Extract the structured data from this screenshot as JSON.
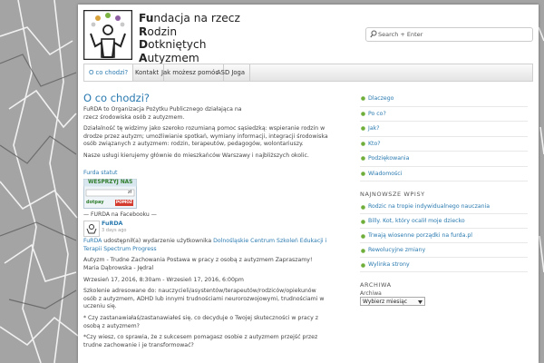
{
  "org": {
    "lines": [
      {
        "first": "Fu",
        "rest": "ndacja na rzecz"
      },
      {
        "first": "R",
        "rest": "odzin"
      },
      {
        "first": "D",
        "rest": "otkniętych"
      },
      {
        "first": "A",
        "rest": "utyzmem"
      }
    ]
  },
  "search": {
    "placeholder": "Search + Enter",
    "icon": "search-icon"
  },
  "nav": {
    "items": [
      "O co chodzi?",
      "Kontakt",
      "Jak możesz pomóc",
      "ASD Joga"
    ],
    "active_index": 0
  },
  "main": {
    "title": "O co chodzi?",
    "p1": "FuRDA to Organizacja Pożytku Publicznego działająca na rzecz środowiska osób z autyzmem.",
    "p2": "Działalność tę widzimy jako szeroko rozumianą pomoc sąsiedzką: wspieranie rodzin w drodze przez autyzm; umożliwianie spotkań, wymiany informacji, integracji środowiska osób związanych z autyzmem: rodzin, terapeutów, pedagogów, wolontariuszy.",
    "p3": "Nasze usługi kierujemy głównie do mieszkańców Warszawy i najbliższych okolic.",
    "statute_link": "Furda statut",
    "donate": {
      "title": "WESPRZYJ NAS",
      "currency": "zł",
      "brand": "dotpay",
      "button": "POMÓŻ"
    },
    "fb_header": "— FURDA na Facebooku —",
    "fb_name": "FuRDA",
    "fb_time": "3 days ago",
    "post": {
      "author": "FuRDA",
      "shared_text": " udostępnił(a) wydarzenie użytkownika ",
      "event_org": "Dolnośląskie Centrum Szkoleń Edukacji i Terapii Spectrum Progress",
      "event_title": "Autyzm - Trudne Zachowania Postawa w pracy z osobą z autyzmem Zapraszamy! Maria Dąbrowska - Jędral",
      "event_date": "Wrzesień 17, 2016, 8:30am - Wrzesień 17, 2016, 6:00pm",
      "desc1": "Szkolenie adresowane do: nauczycieli/asystentów/terapeutów/rodziców/opiekunów osób z autyzmem, ADHD lub innymi trudnościami neurorozwojowymi, trudnościami w uczeniu się.",
      "desc2": "* Czy zastanawiałaś/zastanawiałeś się, co decyduje o Twojej skuteczności w pracy z osobą z autyzmem?",
      "desc3": "*Czy wiesz, co sprawia, że z sukcesem pomagasz osobie z autyzmem przejść przez trudne zachowanie i je transformować?"
    }
  },
  "sidebar": {
    "menu": [
      "Dlaczego",
      "Po co?",
      "Jak?",
      "Kto?",
      "Podziękowania",
      "Wiadomości"
    ],
    "recent_title": "NAJNOWSZE WPISY",
    "recent": [
      "Rodzic na tropie indywidualnego nauczania",
      "Billy. Kot, który ocalił moje dziecko",
      "Trwają wiosenne porządki na furda.pl",
      "Rewolucyjne zmiany",
      "Wylinka strony"
    ],
    "archive_title": "ARCHIWA",
    "archive_label": "Archiwa",
    "archive_select": "Wybierz miesiąc"
  },
  "colors": {
    "accent": "#2a7ab0",
    "bullet": "#6fae3a",
    "nav_active_bg": "#ffffff"
  }
}
